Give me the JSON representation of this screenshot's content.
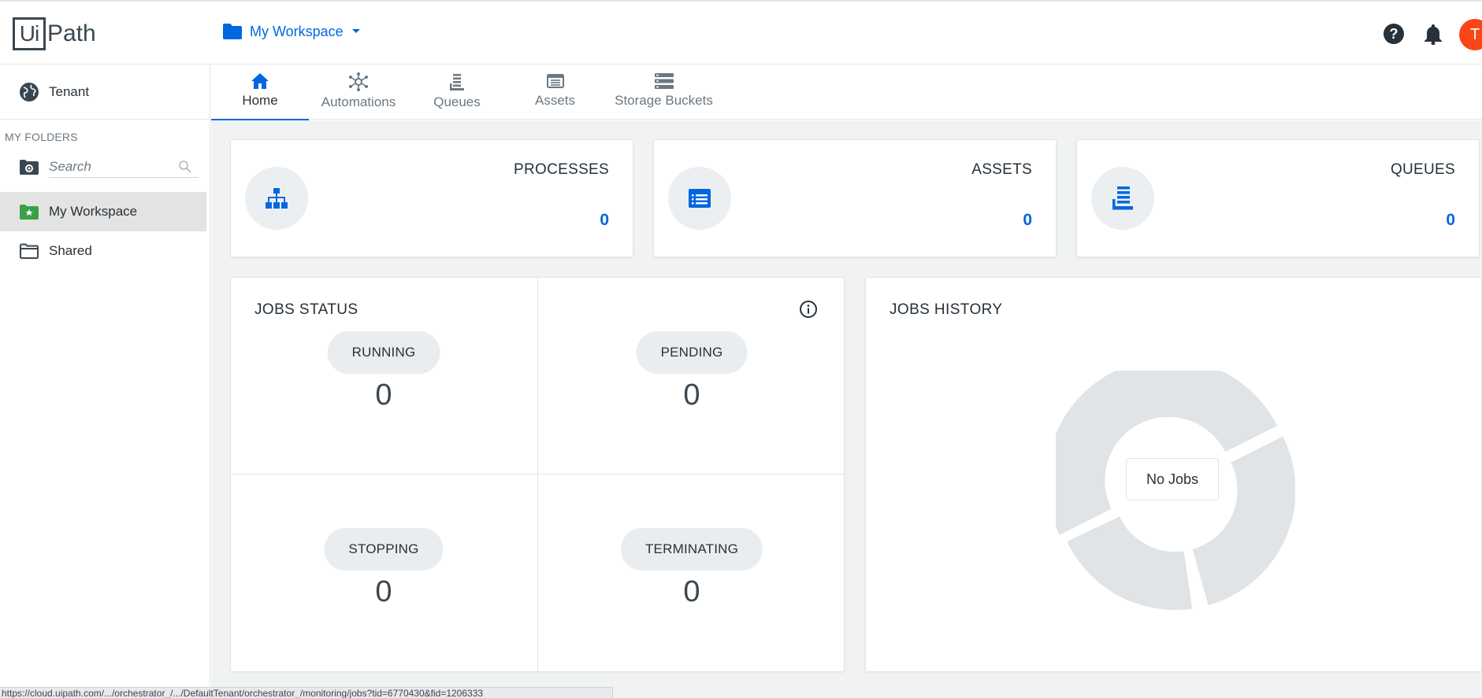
{
  "header": {
    "logo_ui": "Ui",
    "logo_path": "Path",
    "workspace_label": "My Workspace",
    "avatar_initial": "T",
    "brand_color": "#0067df",
    "avatar_color": "#fa4616"
  },
  "sidebar": {
    "tenant_label": "Tenant",
    "section_label": "MY FOLDERS",
    "search_placeholder": "Search",
    "folders": [
      {
        "label": "My Workspace",
        "active": true,
        "icon": "workspace-folder-icon"
      },
      {
        "label": "Shared",
        "active": false,
        "icon": "folder-icon"
      }
    ]
  },
  "tabs": [
    {
      "label": "Home",
      "icon": "home-icon",
      "active": true
    },
    {
      "label": "Automations",
      "icon": "automations-icon",
      "active": false
    },
    {
      "label": "Queues",
      "icon": "queues-icon",
      "active": false
    },
    {
      "label": "Assets",
      "icon": "assets-icon",
      "active": false
    },
    {
      "label": "Storage Buckets",
      "icon": "storage-buckets-icon",
      "active": false
    }
  ],
  "stats": [
    {
      "title": "PROCESSES",
      "value": "0",
      "icon": "processes-icon"
    },
    {
      "title": "ASSETS",
      "value": "0",
      "icon": "assets-icon"
    },
    {
      "title": "QUEUES",
      "value": "0",
      "icon": "queues-icon"
    }
  ],
  "jobs_status": {
    "title": "JOBS STATUS",
    "running_label": "RUNNING",
    "running_count": "0",
    "pending_label": "PENDING",
    "pending_count": "0",
    "stopping_label": "STOPPING",
    "stopping_count": "0",
    "terminating_label": "TERMINATING",
    "terminating_count": "0"
  },
  "jobs_history": {
    "title": "JOBS HISTORY",
    "empty_label": "No Jobs"
  },
  "statusbar": {
    "url": "https://cloud.uipath.com/.../orchestrator_/.../DefaultTenant/orchestrator_/monitoring/jobs?tid=6770430&fid=1206333"
  }
}
